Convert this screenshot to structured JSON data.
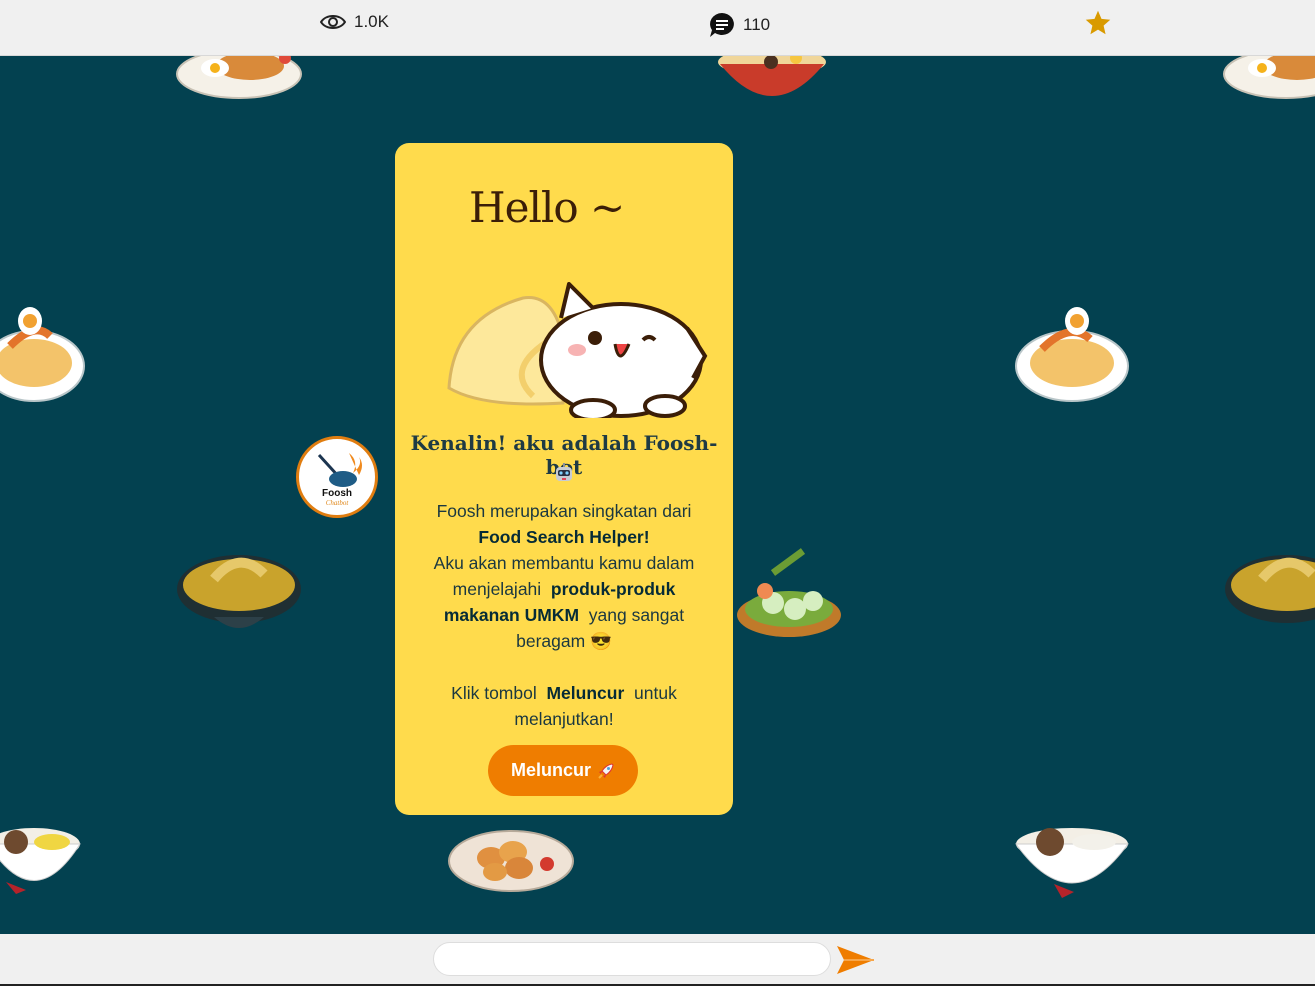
{
  "topbar": {
    "views": "1.0K",
    "comments": "110",
    "icons": [
      "eye-icon",
      "comment-icon",
      "star-icon"
    ],
    "star_color": "#d99a00"
  },
  "card": {
    "greeting": "Hello ~",
    "title": "Kenalin! aku adalah Foosh-bot",
    "line1": "Foosh merupakan singkatan dari",
    "acronym": "Food Search Helper!",
    "line2a": "Aku akan membantu kamu dalam menjelajahi",
    "highlight": "produk-produk makanan UMKM",
    "line2b": "yang sangat beragam",
    "line3a": "Klik tombol",
    "button_name": "Meluncur",
    "line3b": "untuk melanjutkan!",
    "button_label": "Meluncur",
    "background": "#ffdb4c"
  },
  "avatar": {
    "name": "Foosh",
    "tagline": "Chatbot"
  },
  "chat": {
    "placeholder": ""
  },
  "colors": {
    "accent": "#ef7d00",
    "stage": "#034150",
    "bar": "#f0f0f0"
  }
}
